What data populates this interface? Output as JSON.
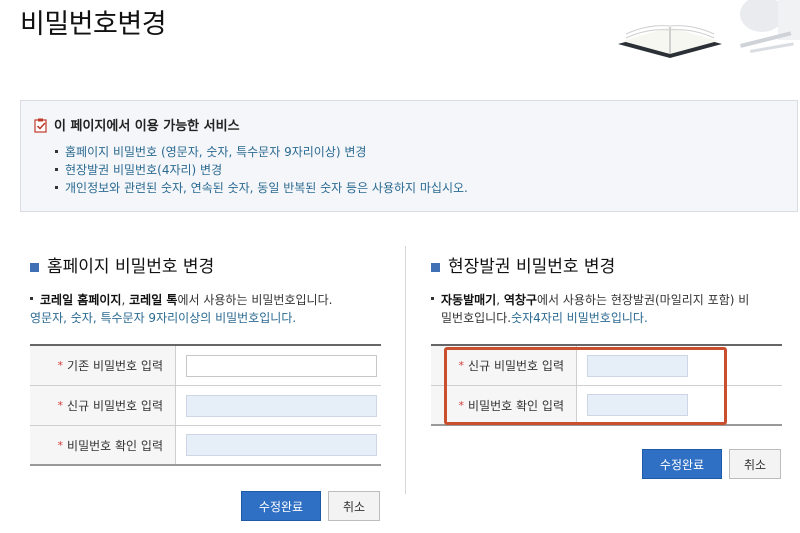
{
  "page": {
    "title": "비밀번호변경"
  },
  "info": {
    "title": "이 페이지에서 이용 가능한 서비스",
    "items": [
      "홈페이지 비밀번호 (영문자, 숫자, 특수문자 9자리이상) 변경",
      "현장발권 비밀번호(4자리) 변경",
      "개인정보와 관련된 숫자, 연속된 숫자, 동일 반복된 숫자 등은 사용하지 마십시오."
    ]
  },
  "homepage": {
    "title": "홈페이지 비밀번호 변경",
    "desc": {
      "b1": "코레일 홈페이지",
      "sep": ", ",
      "b2": "코레일 톡",
      "rest": "에서 사용하는 비밀번호입니다.",
      "blue": "영문자, 숫자, 특수문자 9자리이상의 비밀번호입니다."
    },
    "fields": [
      {
        "label": "기존 비밀번호 입력",
        "value": ""
      },
      {
        "label": "신규 비밀번호 입력",
        "value": ""
      },
      {
        "label": "비밀번호 확인 입력",
        "value": ""
      }
    ],
    "submit": "수정완료",
    "cancel": "취소"
  },
  "onsite": {
    "title": "현장발권 비밀번호 변경",
    "desc": {
      "b1": "자동발매기",
      "sep": ", ",
      "b2": "역창구",
      "rest1": "에서 사용하는 현장발권(마일리지 포함) 비",
      "rest2": "밀번호입니다.",
      "blue": "숫자4자리 비밀번호입니다."
    },
    "fields": [
      {
        "label": "신규 비밀번호 입력",
        "value": ""
      },
      {
        "label": "비밀번호 확인 입력",
        "value": ""
      }
    ],
    "submit": "수정완료",
    "cancel": "취소"
  },
  "required_mark": "*",
  "colors": {
    "accent": "#2f6fc4",
    "highlight": "#c9502f",
    "link": "#2b6a91"
  }
}
